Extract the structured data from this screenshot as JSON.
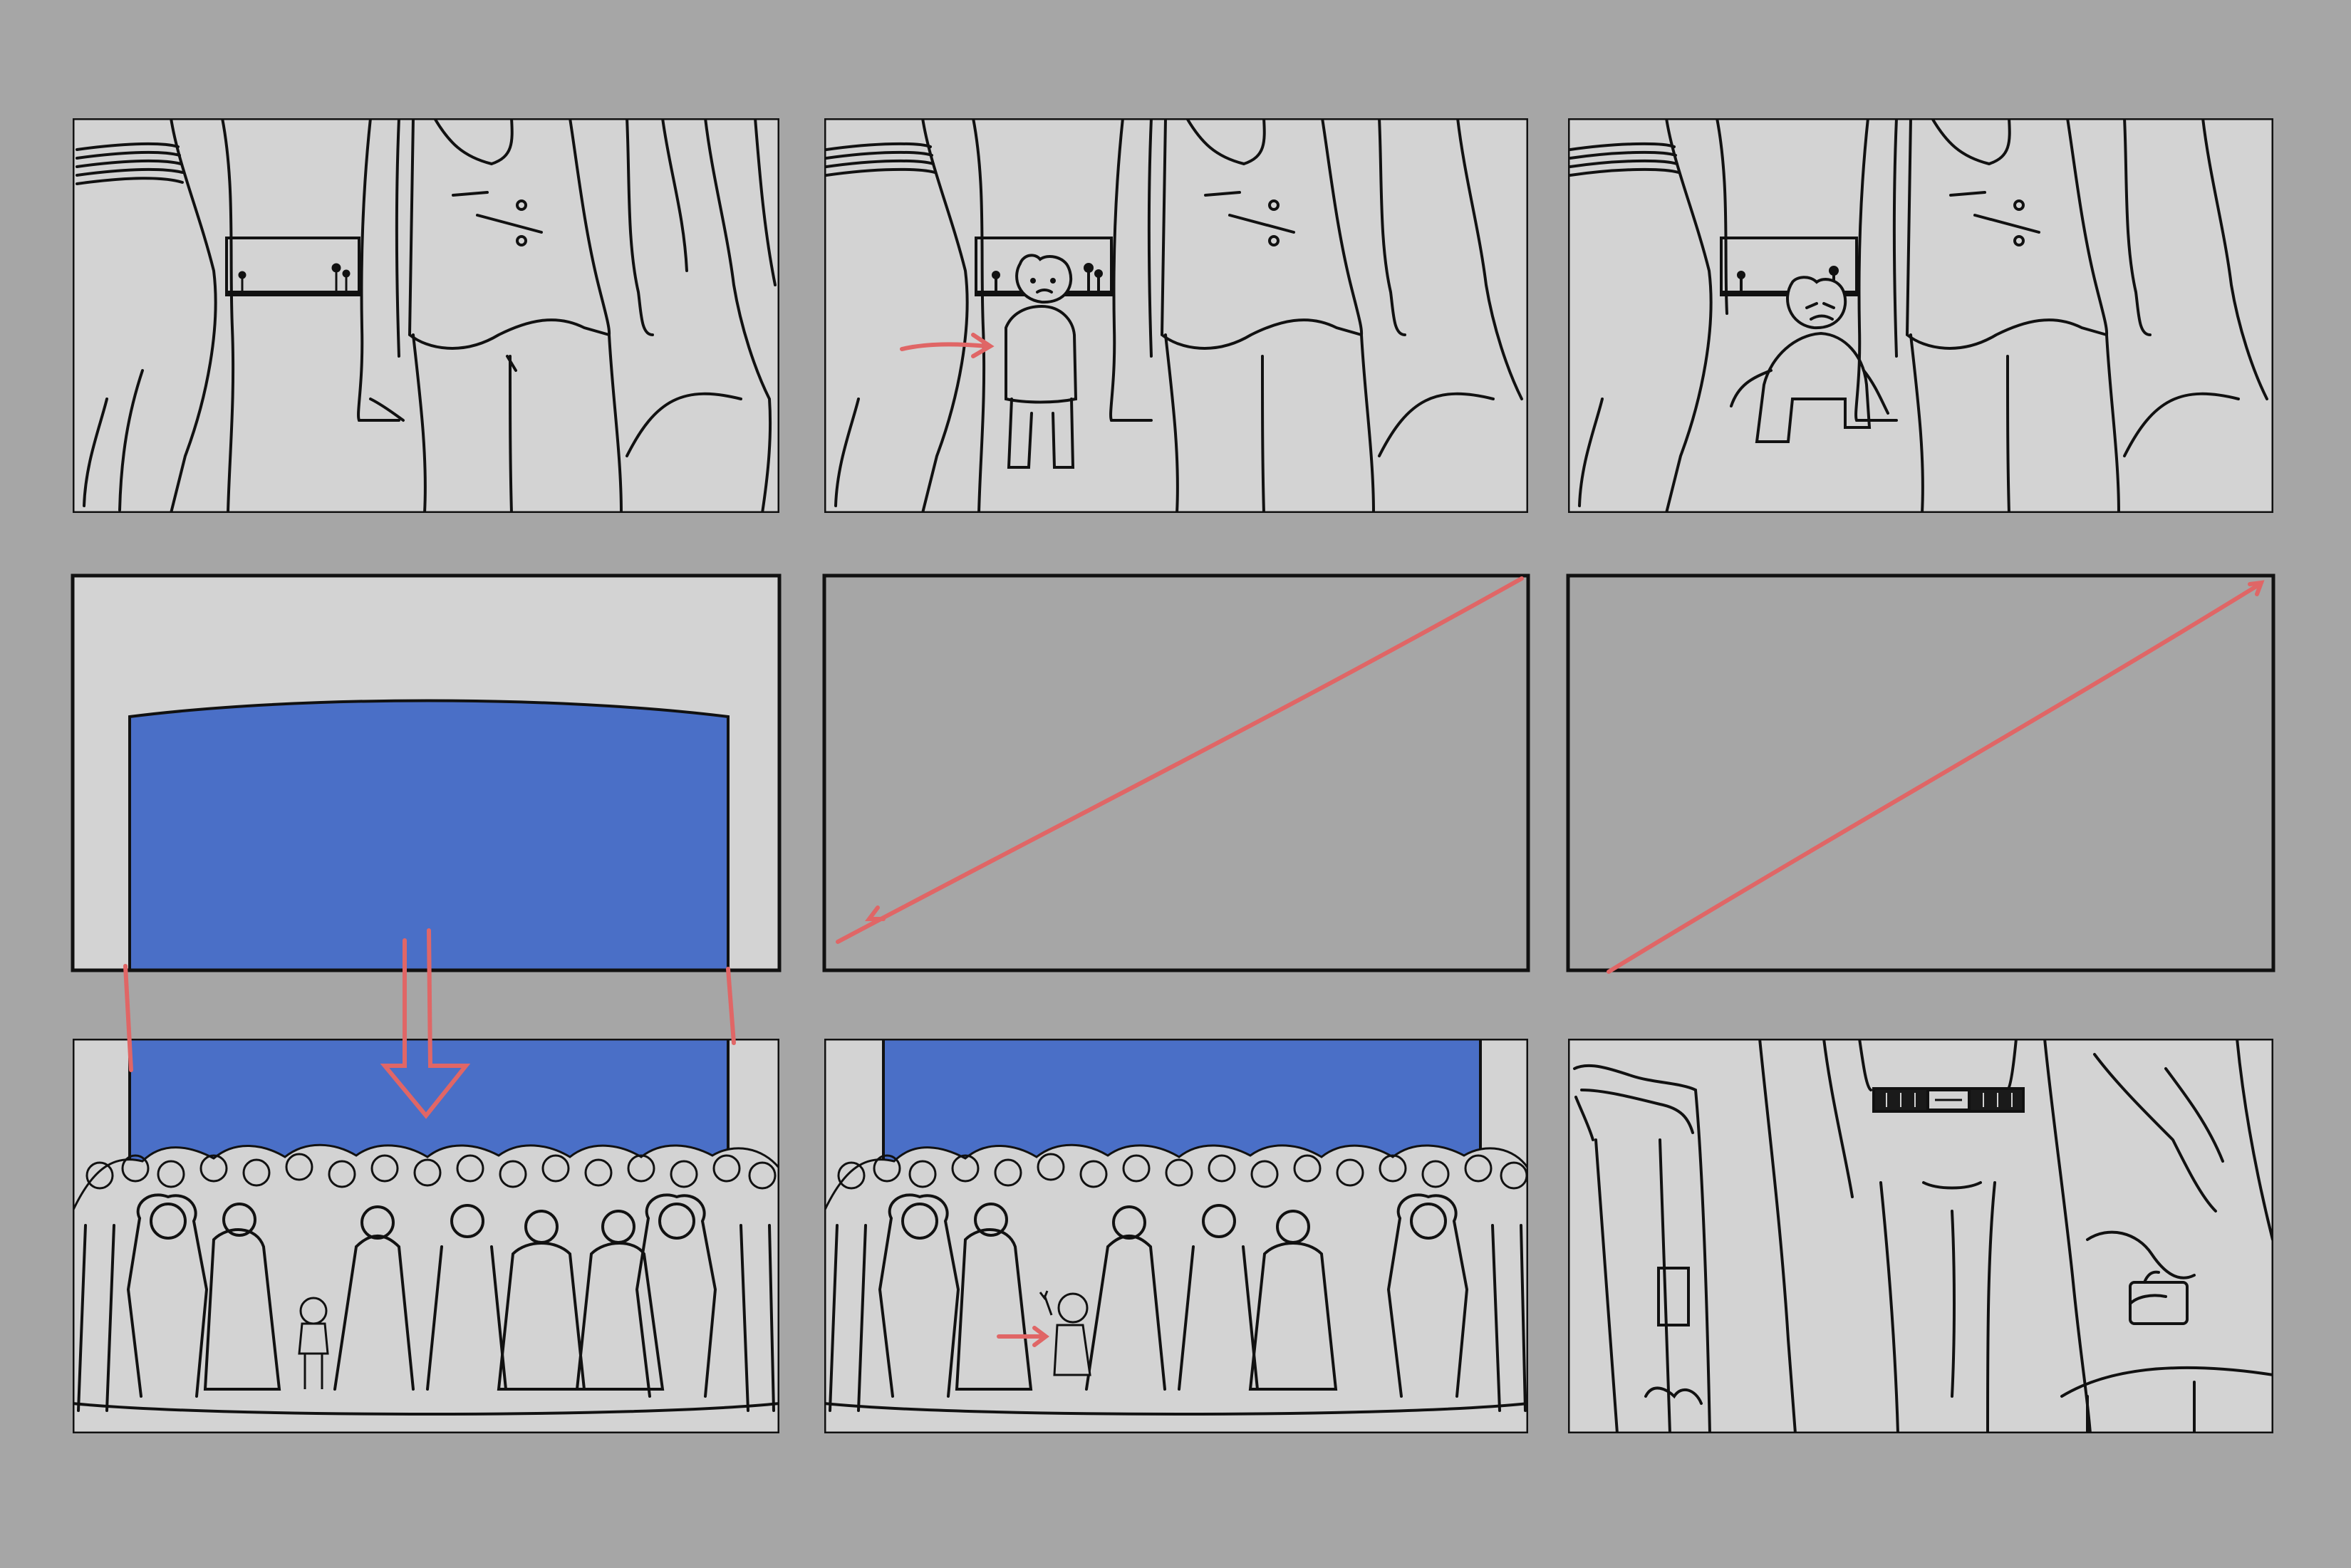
{
  "board": {
    "background": "#a6a6a6",
    "panel_fill": "#d3d3d3",
    "empty_panel_fill": "#a6a6a6",
    "ink_color": "#111111",
    "accent_arrow_color": "#e06666",
    "sky_color": "#4a6fc7"
  },
  "panels": [
    {
      "id": "panel-1",
      "content": "legs-and-window-with-tiny-figures"
    },
    {
      "id": "panel-2",
      "content": "child-steps-into-window-with-arrow"
    },
    {
      "id": "panel-3",
      "content": "child-crouching-pushing-through"
    },
    {
      "id": "panel-4",
      "content": "blue-stage-backdrop"
    },
    {
      "id": "panel-5",
      "content": "empty-transition-pan-line"
    },
    {
      "id": "panel-6",
      "content": "empty-transition-pan-line"
    },
    {
      "id": "panel-7",
      "content": "crowd-with-child-below-blue-backdrop"
    },
    {
      "id": "panel-8",
      "content": "crowd-child-waving-with-arrow"
    },
    {
      "id": "panel-9",
      "content": "close-up-of-adult-legs-and-belt"
    }
  ]
}
